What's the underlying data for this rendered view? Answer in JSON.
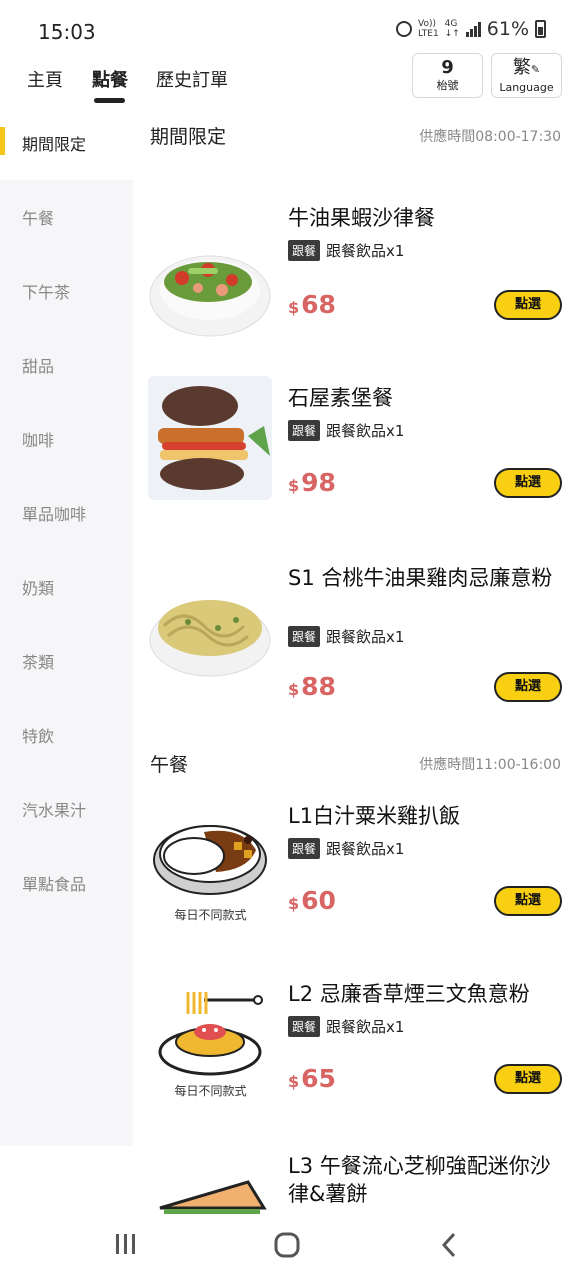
{
  "status": {
    "time": "15:03",
    "network": "VoLTE1",
    "net_type": "4G",
    "battery": "61%"
  },
  "nav": {
    "tabs": [
      {
        "label": "主頁"
      },
      {
        "label": "點餐"
      },
      {
        "label": "歷史訂單"
      }
    ],
    "active_tab": "點餐",
    "order_number": "9",
    "order_label": "枱號",
    "lang_char": "繁",
    "lang_label": "Language"
  },
  "sidebar": {
    "items": [
      {
        "label": "期間限定"
      },
      {
        "label": "午餐"
      },
      {
        "label": "下午茶"
      },
      {
        "label": "甜品"
      },
      {
        "label": "咖啡"
      },
      {
        "label": "單品咖啡"
      },
      {
        "label": "奶類"
      },
      {
        "label": "茶類"
      },
      {
        "label": "特飲"
      },
      {
        "label": "汽水果汁"
      },
      {
        "label": "單點食品"
      }
    ]
  },
  "sections": [
    {
      "title": "期間限定",
      "hours": "供應時間08:00-17:30",
      "items": [
        {
          "name": "牛油果蝦沙律餐",
          "tag": "跟餐",
          "extra": "跟餐飲品x1",
          "currency": "$",
          "price": "68",
          "button": "點選",
          "image": "salad-image"
        },
        {
          "name": "石屋素堡餐",
          "tag": "跟餐",
          "extra": "跟餐飲品x1",
          "currency": "$",
          "price": "98",
          "button": "點選",
          "image": "burger-image"
        },
        {
          "name": "S1 合桃牛油果雞肉忌廉意粉",
          "tag": "跟餐",
          "extra": "跟餐飲品x1",
          "currency": "$",
          "price": "88",
          "button": "點選",
          "image": "pasta-image"
        }
      ]
    },
    {
      "title": "午餐",
      "hours": "供應時間11:00-16:00",
      "items": [
        {
          "name": "L1白汁粟米雞扒飯",
          "tag": "跟餐",
          "extra": "跟餐飲品x1",
          "currency": "$",
          "price": "60",
          "button": "點選",
          "image": "curry-rice-illustration",
          "caption": "每日不同款式"
        },
        {
          "name": "L2 忌廉香草煙三文魚意粉",
          "tag": "跟餐",
          "extra": "跟餐飲品x1",
          "currency": "$",
          "price": "65",
          "button": "點選",
          "image": "spaghetti-illustration",
          "caption": "每日不同款式"
        },
        {
          "name": "L3 午餐流心芝柳強配迷你沙律&薯餅",
          "image": "sandwich-illustration"
        }
      ]
    }
  ],
  "colors": {
    "accent": "#f8cf11",
    "price": "#d96464",
    "marker": "#f5c518"
  }
}
